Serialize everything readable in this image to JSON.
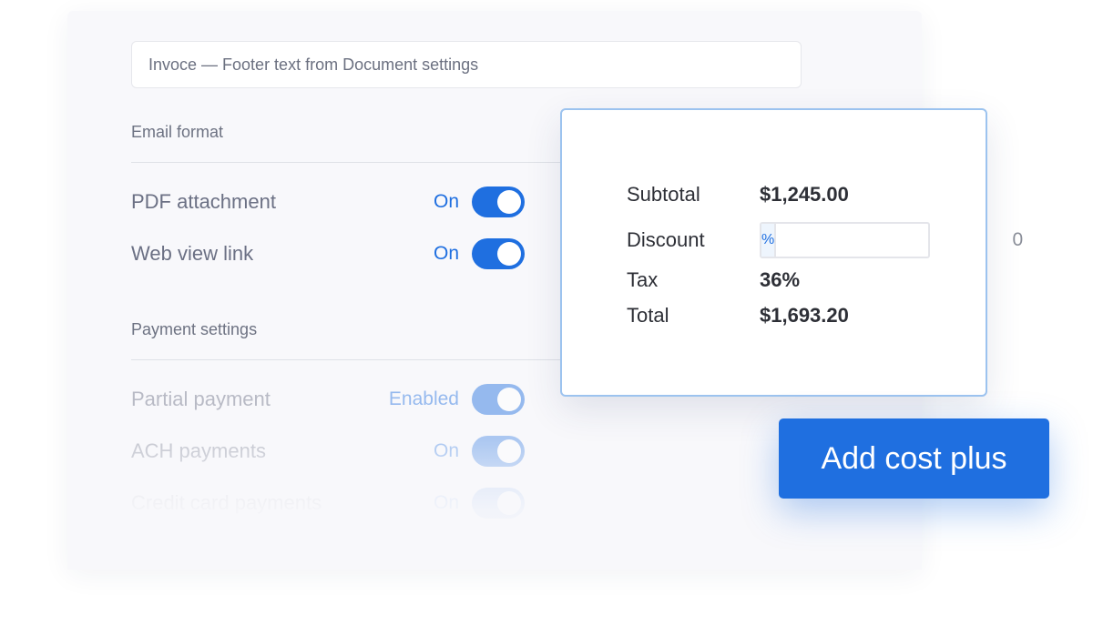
{
  "settings": {
    "footer_field_value": "Invoce — Footer text from Document settings",
    "email_section": {
      "title": "Email format",
      "rows": [
        {
          "label": "PDF attachment",
          "state": "On",
          "enabled": true
        },
        {
          "label": "Web view link",
          "state": "On",
          "enabled": true
        }
      ]
    },
    "payment_section": {
      "title": "Payment settings",
      "rows": [
        {
          "label": "Partial payment",
          "state": "Enabled",
          "enabled": true
        },
        {
          "label": "ACH payments",
          "state": "On",
          "enabled": true
        },
        {
          "label": "Credit card payments",
          "state": "On",
          "enabled": true
        }
      ]
    }
  },
  "totals": {
    "subtotal_label": "Subtotal",
    "subtotal_value": "$1,245.00",
    "discount_label": "Discount",
    "discount_unit": "%",
    "discount_value": "0",
    "tax_label": "Tax",
    "tax_value": "36%",
    "total_label": "Total",
    "total_value": "$1,693.20"
  },
  "cta": {
    "label": "Add cost plus"
  },
  "colors": {
    "accent": "#1f6fe0",
    "card_border": "#9cc3ef",
    "panel_bg": "#f8f8fb"
  }
}
